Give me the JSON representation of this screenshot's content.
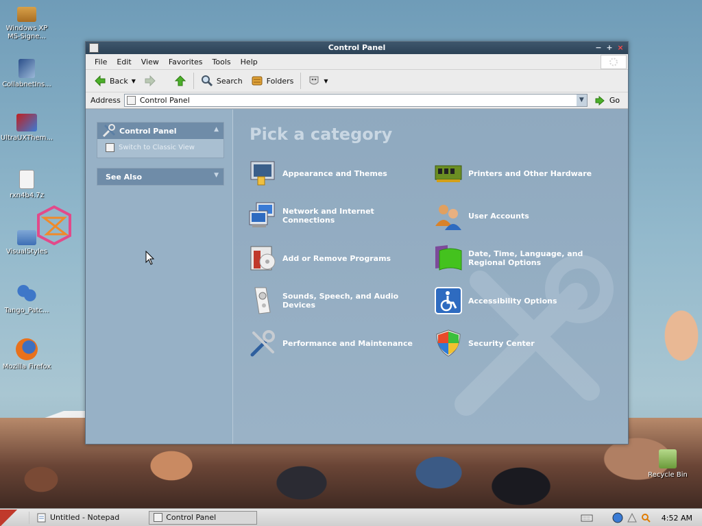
{
  "desktop": {
    "icons": [
      {
        "label": "Windows XP MS-Signe...",
        "icon": "package-icon"
      },
      {
        "label": "CollabnetIns...",
        "icon": "installer-icon"
      },
      {
        "label": "UltraUXThem...",
        "icon": "monitor-icon"
      },
      {
        "label": "rxn4b4.7z",
        "icon": "file-icon"
      },
      {
        "label": "VisualStyles",
        "icon": "folder-icon"
      },
      {
        "label": "Tango_Patc...",
        "icon": "footprints-icon"
      },
      {
        "label": "Mozilla Firefox",
        "icon": "firefox-icon"
      }
    ],
    "recycle_bin": "Recycle Bin"
  },
  "window": {
    "title": "Control Panel",
    "menu": [
      "File",
      "Edit",
      "View",
      "Favorites",
      "Tools",
      "Help"
    ],
    "toolbar": {
      "back": "Back",
      "search": "Search",
      "folders": "Folders"
    },
    "address": {
      "label": "Address",
      "value": "Control Panel",
      "go": "Go"
    }
  },
  "sidebar": {
    "panel_title": "Control Panel",
    "switch_view": "Switch to Classic View",
    "see_also": "See Also"
  },
  "main": {
    "heading": "Pick a category",
    "categories_left": [
      {
        "label": "Appearance and Themes",
        "icon": "appearance-icon"
      },
      {
        "label": "Network and Internet Connections",
        "icon": "network-icon"
      },
      {
        "label": "Add or Remove Programs",
        "icon": "add-remove-programs-icon"
      },
      {
        "label": "Sounds, Speech, and Audio Devices",
        "icon": "audio-icon"
      },
      {
        "label": "Performance and Maintenance",
        "icon": "tools-icon"
      }
    ],
    "categories_right": [
      {
        "label": "Printers and Other Hardware",
        "icon": "hardware-icon"
      },
      {
        "label": "User Accounts",
        "icon": "users-icon"
      },
      {
        "label": "Date, Time, Language, and Regional Options",
        "icon": "regional-icon"
      },
      {
        "label": "Accessibility Options",
        "icon": "accessibility-icon"
      },
      {
        "label": "Security Center",
        "icon": "shield-icon"
      }
    ]
  },
  "taskbar": {
    "tasks": [
      "Untitled - Notepad",
      "Control Panel"
    ],
    "clock": "4:52 AM"
  }
}
